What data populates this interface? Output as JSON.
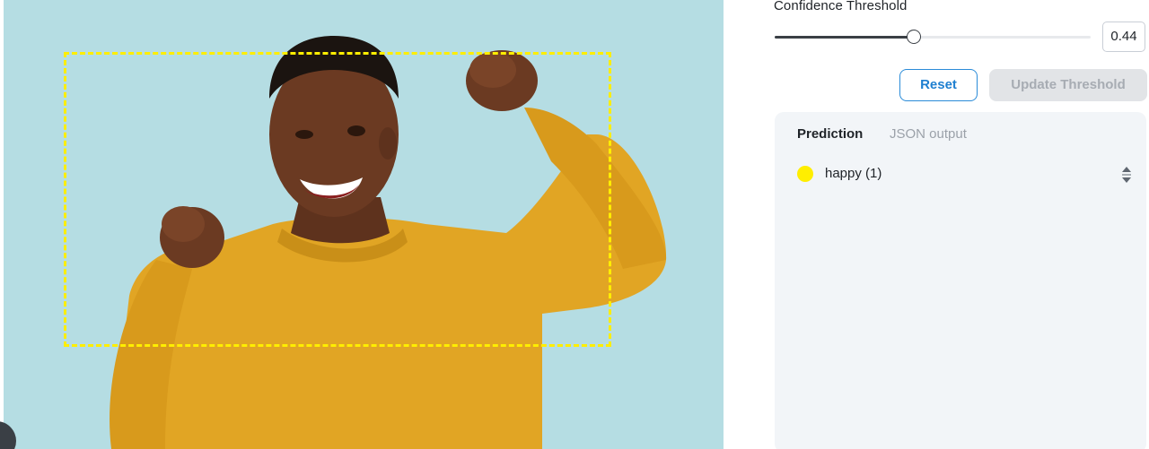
{
  "threshold": {
    "label": "Confidence Threshold",
    "value": "0.44",
    "slider_fraction": 0.44
  },
  "buttons": {
    "reset_label": "Reset",
    "update_label": "Update Threshold"
  },
  "prediction_panel": {
    "tabs": [
      {
        "label": "Prediction",
        "active": true
      },
      {
        "label": "JSON output",
        "active": false
      }
    ],
    "items": [
      {
        "label": "happy (1)",
        "color": "#ffee00"
      }
    ]
  },
  "detection": {
    "box_color": "#ffee00"
  },
  "colors": {
    "accent": "#1e7fd0",
    "slider": "#3a3f45",
    "panel_bg": "#f2f5f8",
    "image_bg": "#b5dde3",
    "sweater": "#e1a524"
  },
  "icons": {
    "sort": "sort-arrows-icon",
    "knob": "corner-knob"
  }
}
